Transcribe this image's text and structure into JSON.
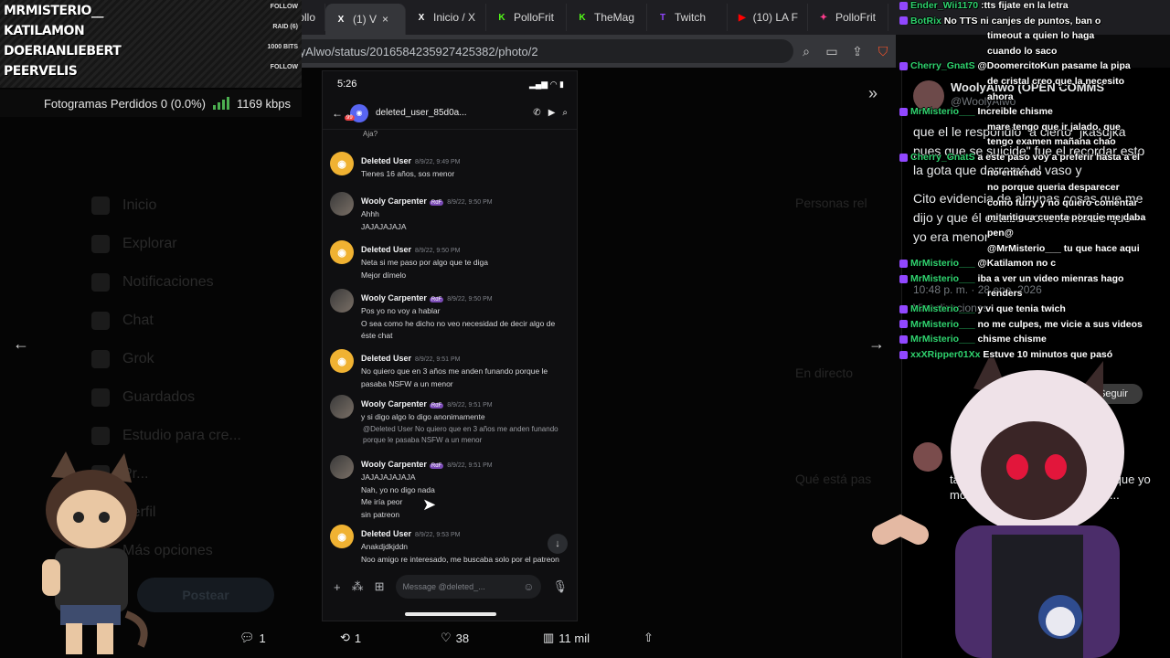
{
  "browser": {
    "tabs": [
      {
        "label": "ollo",
        "icon": "",
        "color": "#888888"
      },
      {
        "label": "(1) V",
        "icon": "X",
        "color": "#ffffff",
        "active": true
      },
      {
        "label": "Inicio / X",
        "icon": "X",
        "color": "#ffffff"
      },
      {
        "label": "PolloFrit",
        "icon": "K",
        "color": "#53fc18"
      },
      {
        "label": "TheMag",
        "icon": "K",
        "color": "#53fc18"
      },
      {
        "label": "Twitch",
        "icon": "T",
        "color": "#9146ff"
      },
      {
        "label": "(10) LA F",
        "icon": "▶",
        "color": "#ff0000"
      },
      {
        "label": "PolloFrit",
        "icon": "✦",
        "color": "#ff3c8e"
      }
    ],
    "url": "x.com/WoolyAlwo/status/2016584235927425382/photo/2"
  },
  "stream_overlay": {
    "names": [
      "MRMISTERIO__",
      "KATILAMON",
      "DOERIANLIEBERT",
      "PEERVELIS"
    ],
    "tags": [
      "FOLLOW",
      "RAID (6)",
      "1000 BITS",
      "FOLLOW"
    ],
    "stats_text": "Fotogramas Perdidos 0 (0.0%)",
    "bitrate": "1169 kbps",
    "bitrate_color": "#4caf50"
  },
  "x_nav": {
    "items": [
      "Inicio",
      "Explorar",
      "Notificaciones",
      "Chat",
      "Grok",
      "Guardados",
      "Estudio para cre...",
      "Pr...",
      "Perfil",
      "Más opciones"
    ],
    "post_button": "Postear"
  },
  "right_column": {
    "items": [
      "Personas rel",
      "En directo",
      "Qué está pas"
    ]
  },
  "phone": {
    "time": "5:26",
    "header_name": "deleted_user_85d0a...",
    "header_badge": "99",
    "messages": [
      {
        "user": "Deleted User",
        "time": "8/9/22, 9:49 PM",
        "avatar": "deleted",
        "lines": [
          "Tienes 16 años, sos menor"
        ]
      },
      {
        "user": "Wooly Carpenter",
        "time": "8/9/22, 9:50 PM",
        "avatar": "wooly",
        "tag": "RdF",
        "lines": [
          "Ahhh",
          "JAJAJAJAJA"
        ]
      },
      {
        "user": "Deleted User",
        "time": "8/9/22, 9:50 PM",
        "avatar": "deleted",
        "lines": [
          "Neta si me paso por algo que te diga",
          "Mejor dímelo"
        ]
      },
      {
        "user": "Wooly Carpenter",
        "time": "8/9/22, 9:50 PM",
        "avatar": "wooly",
        "tag": "RdF",
        "lines": [
          "Pos yo no voy a hablar",
          "O sea como he dicho no veo necesidad de decir algo de",
          "éste chat"
        ]
      },
      {
        "user": "Deleted User",
        "time": "8/9/22, 9:51 PM",
        "avatar": "deleted",
        "lines": [
          "No quiero que en 3 años me anden funando porque le",
          "pasaba NSFW a un menor"
        ]
      },
      {
        "user": "Wooly Carpenter",
        "time": "8/9/22, 9:51 PM",
        "avatar": "wooly",
        "tag": "RdF",
        "lines": [
          "y si digo algo lo digo anonimamente"
        ]
      },
      {
        "user": "Wooly Carpenter",
        "time": "8/9/22, 9:51 PM",
        "avatar": "wooly",
        "tag": "RdF",
        "lines": [
          "JAJAJAJAJAJA",
          "Nah, yo no digo nada",
          "Me iría peor",
          "sin patreon"
        ]
      },
      {
        "user": "Deleted User",
        "time": "8/9/22, 9:53 PM",
        "avatar": "deleted",
        "lines": [
          "Anakdjdkjddn",
          "Noo amigo re interesado, me buscaba solo por el patreon"
        ]
      }
    ],
    "top_fragment": "Aja?",
    "reply_quote": "@Deleted User No quiero que en 3 años me anden funando porque le pasaba NSFW a un menor",
    "input_placeholder": "Message @deleted_..."
  },
  "actions": {
    "replies": "1",
    "reposts": "1",
    "likes": "38",
    "views": "11 mil"
  },
  "tweet": {
    "author": "WoolyAlwo (OPEN COMMS",
    "handle": "@WoolyAlwo",
    "paragraphs": [
      "que el le respondió \"a cierto\" jkasdjka pues que se suicide\" fue el recordar esto la gota que derramó el vaso y",
      "Cito evidencia de algunas cosas que me dijo y que él estaba consciente de que yo era menor"
    ],
    "timestamp": "10:48 p. m. · 28 ene. 2026",
    "views": "Visualizaciones",
    "follow": "Seguir",
    "reply_fragment": "también porque algunas cosas que yo mostrando de groomer me fue..."
  },
  "chat": [
    {
      "name": "Ender_Wii1170",
      "text": ":tts fijate en la letra"
    },
    {
      "name": "BotRix",
      "text": "No TTS ni canjes de puntos, ban o"
    },
    {
      "name": "",
      "text": "timeout a quien lo haga"
    },
    {
      "name": "",
      "text": "cuando lo saco"
    },
    {
      "name": "Cherry_GnatS",
      "text": "@DoomercitoKun pasame la pipa"
    },
    {
      "name": "",
      "text": "de cristal creo que la necesito"
    },
    {
      "name": "",
      "text": "ahora"
    },
    {
      "name": "MrMisterio___",
      "text": "Increible chisme"
    },
    {
      "name": "",
      "text": "mare tengo que ir jalado, que"
    },
    {
      "name": "",
      "text": "tengo examen mañana chao"
    },
    {
      "name": "Cherry_GnatS",
      "text": "a este paso voy a preferir hasta a el"
    },
    {
      "name": "",
      "text": "no entiendo"
    },
    {
      "name": "",
      "text": "no porque queria desparecer"
    },
    {
      "name": "",
      "text": "como furry y no quiero comentar"
    },
    {
      "name": "",
      "text": "mi antigua cuenta porque me daba"
    },
    {
      "name": "",
      "text": "pen@"
    },
    {
      "name": "",
      "text": "@MrMisterio___ tu que hace aqui"
    },
    {
      "name": "MrMisterio___",
      "text": "@Katilamon no c"
    },
    {
      "name": "MrMisterio___",
      "text": "iba a ver un video mienras hago"
    },
    {
      "name": "",
      "text": "renders"
    },
    {
      "name": "MrMisterio___",
      "text": "y vi que tenia twich"
    },
    {
      "name": "MrMisterio___",
      "text": "no me culpes, me vicie a sus videos"
    },
    {
      "name": "MrMisterio___",
      "text": "chisme chisme"
    },
    {
      "name": "xxXRipper01Xx",
      "text": "Estuve 10 minutos que pasó"
    }
  ]
}
